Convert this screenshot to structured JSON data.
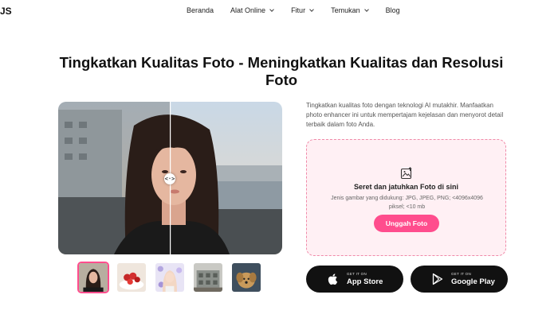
{
  "brand": {
    "logo_fragment": "JS"
  },
  "nav": {
    "items": [
      {
        "label": "Beranda",
        "has_dropdown": false
      },
      {
        "label": "Alat Online",
        "has_dropdown": true
      },
      {
        "label": "Fitur",
        "has_dropdown": true
      },
      {
        "label": "Temukan",
        "has_dropdown": true
      },
      {
        "label": "Blog",
        "has_dropdown": false
      }
    ]
  },
  "hero": {
    "title_line1": "Tingkatkan Kualitas Foto - Meningkatkan Kualitas dan Resolusi",
    "title_line2": "Foto",
    "description": "Tingkatkan kualitas foto dengan teknologi AI mutakhir. Manfaatkan photo enhancer ini untuk mempertajam kejelasan dan menyorot detail terbaik dalam foto Anda.",
    "compare_handle_glyph": "<·>"
  },
  "dropzone": {
    "icon": "image-upload-icon",
    "title": "Seret dan jatuhkan Foto di sini",
    "subtitle": "Jenis gambar yang didukung: JPG, JPEG, PNG; <4096x4096 piksel; <10 mb",
    "button_label": "Unggah Foto"
  },
  "thumbnails": [
    {
      "name": "portrait-woman",
      "active": true
    },
    {
      "name": "cake",
      "active": false
    },
    {
      "name": "girl-flowers",
      "active": false
    },
    {
      "name": "building",
      "active": false
    },
    {
      "name": "puppy",
      "active": false
    }
  ],
  "stores": {
    "apple": {
      "small": "GET IT ON",
      "big": "App Store",
      "icon": "apple-icon"
    },
    "google": {
      "small": "GET IT ON",
      "big": "Google Play",
      "icon": "play-icon"
    }
  },
  "colors": {
    "accent": "#ff4d8d",
    "dropzone_bg": "#fff0f4",
    "dropzone_border": "#f08aa9",
    "dark": "#111111"
  }
}
